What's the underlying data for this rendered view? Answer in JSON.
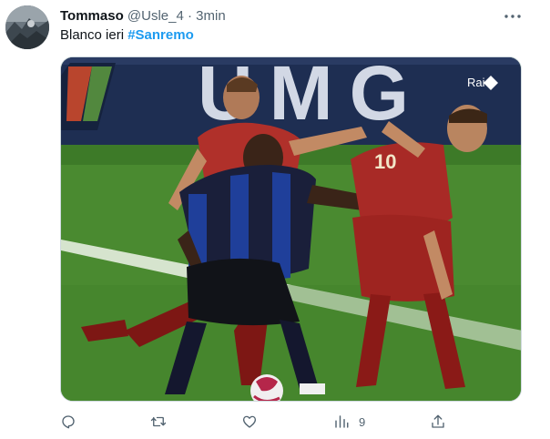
{
  "tweet": {
    "author_name": "Tommaso",
    "handle": "@Usle_4",
    "separator": "·",
    "time": "3min",
    "text_plain": "Blanco ieri ",
    "hashtag": "#Sanremo"
  },
  "media": {
    "banner_text": "UMG",
    "broadcaster_logo": "Rai",
    "player_number": "10"
  },
  "actions": {
    "views_count": "9"
  },
  "icons": {
    "more": "more-horizontal-icon",
    "reply": "reply-icon",
    "retweet": "retweet-icon",
    "like": "heart-icon",
    "views": "views-chart-icon",
    "share": "share-icon"
  },
  "colors": {
    "link": "#1d9bf0",
    "muted": "#536471",
    "text": "#0f1419"
  }
}
